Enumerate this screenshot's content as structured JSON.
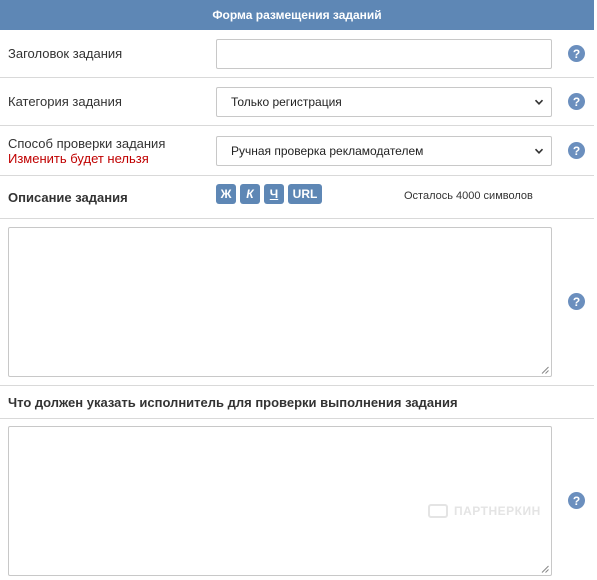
{
  "form": {
    "title": "Форма размещения заданий"
  },
  "fields": {
    "task_title": {
      "label": "Заголовок задания",
      "value": ""
    },
    "category": {
      "label": "Категория задания",
      "value": "Только регистрация"
    },
    "check_method": {
      "label": "Способ проверки задания",
      "warning": "Изменить будет нельзя",
      "value": "Ручная проверка рекламодателем"
    },
    "description": {
      "label": "Описание задания",
      "counter": "Осталось 4000 символов",
      "format_buttons": [
        "Ж",
        "К",
        "Ч",
        "URL"
      ],
      "value": ""
    },
    "proof": {
      "label": "Что должен указать исполнитель для проверки выполнения задания",
      "value": ""
    }
  },
  "help_glyph": "?",
  "icons": [
    "question-circle-icon",
    "chevron-down-icon",
    "resize-grip-icon"
  ],
  "watermark": "ПАРТНЕРКИН",
  "colors": {
    "header_bg": "#5e87b5",
    "help_bg": "#6b8fbe",
    "warning": "#c00000",
    "divider": "#d9d9d9"
  }
}
